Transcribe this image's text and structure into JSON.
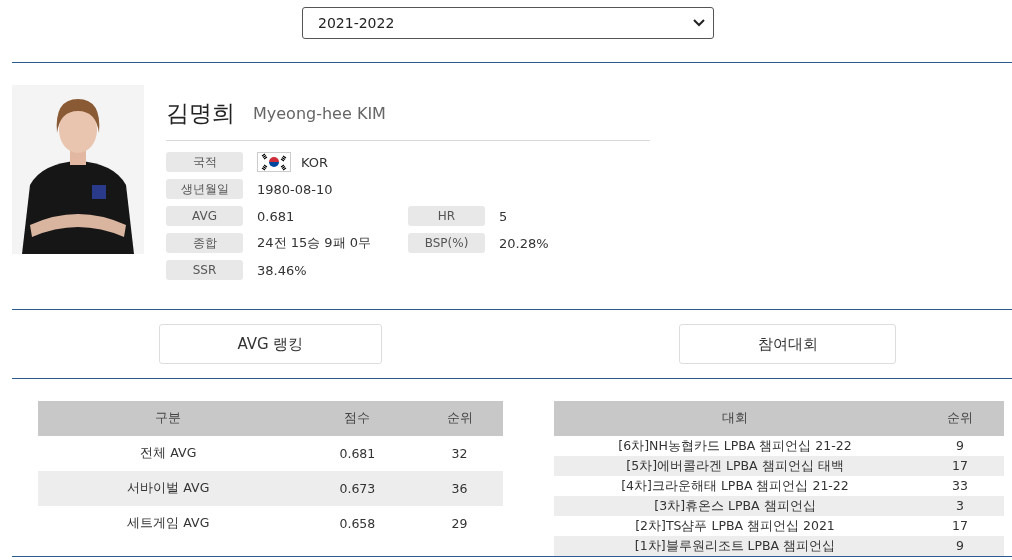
{
  "season_select": {
    "value": "2021-2022"
  },
  "player": {
    "name_ko": "김명희",
    "name_en": "Myeong-hee KIM"
  },
  "info_rows": [
    [
      {
        "label": "국적",
        "value": "KOR",
        "kind": "country"
      }
    ],
    [
      {
        "label": "생년월일",
        "value": "1980-08-10",
        "kind": "text"
      }
    ],
    [
      {
        "label": "AVG",
        "value": "0.681",
        "kind": "text"
      },
      {
        "label": "HR",
        "value": "5",
        "kind": "text"
      }
    ],
    [
      {
        "label": "종합",
        "value": "24전 15승 9패 0무",
        "kind": "text"
      },
      {
        "label": "BSP(%)",
        "value": "20.28%",
        "kind": "text"
      }
    ],
    [
      {
        "label": "SSR",
        "value": "38.46%",
        "kind": "text"
      }
    ]
  ],
  "avg_ranking": {
    "button": "AVG 랭킹",
    "columns": [
      "구분",
      "점수",
      "순위"
    ],
    "rows": [
      [
        "전체 AVG",
        "0.681",
        "32"
      ],
      [
        "서바이벌 AVG",
        "0.673",
        "36"
      ],
      [
        "세트게임 AVG",
        "0.658",
        "29"
      ]
    ]
  },
  "tournaments": {
    "button": "참여대회",
    "columns": [
      "대회",
      "순위"
    ],
    "rows": [
      [
        "[6차]NH농협카드 LPBA 챔피언십 21-22",
        "9"
      ],
      [
        "[5차]에버콜라겐 LPBA 챔피언십 태백",
        "17"
      ],
      [
        "[4차]크라운해태 LPBA 챔피언십 21-22",
        "33"
      ],
      [
        "[3차]휴온스 LPBA 챔피언십",
        "3"
      ],
      [
        "[2차]TS샴푸 LPBA 챔피언십 2021",
        "17"
      ],
      [
        "[1차]블루원리조트 LPBA 챔피언십",
        "9"
      ]
    ]
  }
}
